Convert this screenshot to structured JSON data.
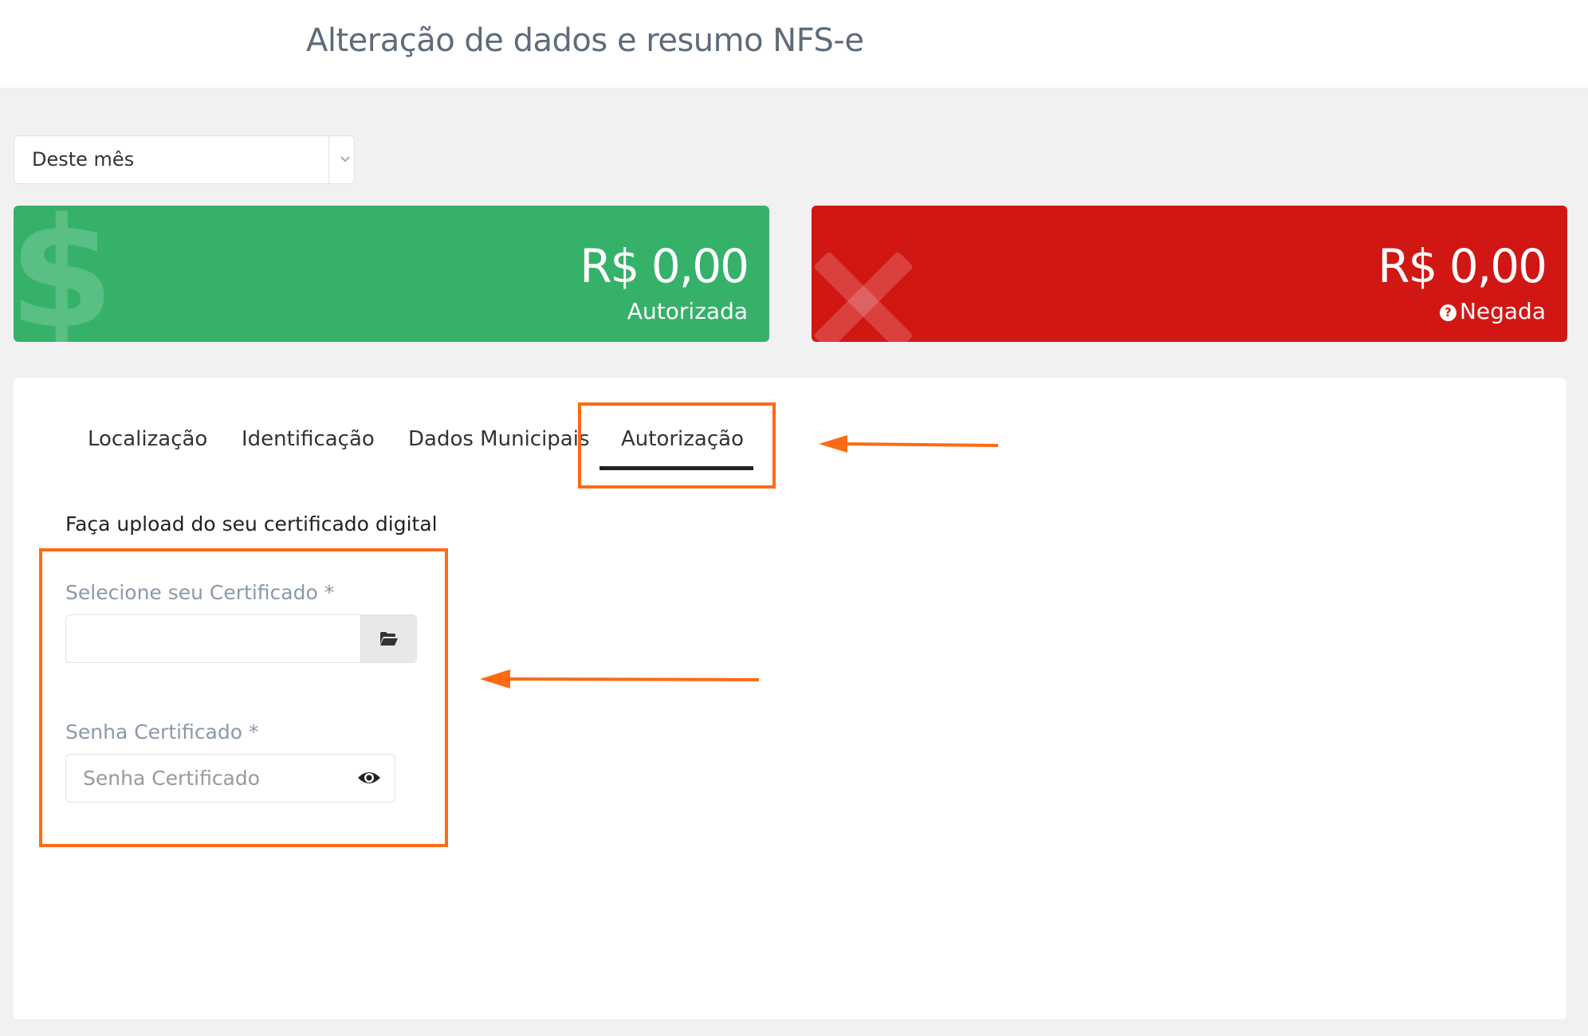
{
  "header": {
    "title": "Alteração de dados e resumo NFS-e"
  },
  "filter": {
    "period_value": "Deste mês"
  },
  "cards": {
    "authorized": {
      "amount": "R$ 0,00",
      "label": "Autorizada",
      "bg_icon": "dollar-icon",
      "color": "#36b16a"
    },
    "denied": {
      "amount": "R$ 0,00",
      "label": "Negada",
      "bg_icon": "close-icon",
      "color": "#d11714"
    }
  },
  "tabs": [
    {
      "label": "Localização",
      "active": false
    },
    {
      "label": "Identificação",
      "active": false
    },
    {
      "label": "Dados Municipais",
      "active": false
    },
    {
      "label": "Autorização",
      "active": true
    }
  ],
  "form": {
    "heading": "Faça upload do seu certificado digital",
    "certificate": {
      "label": "Selecione seu Certificado *",
      "value": "",
      "button_icon": "folder-open-icon"
    },
    "password": {
      "label": "Senha Certificado *",
      "placeholder": "Senha Certificado",
      "value": "",
      "toggle_icon": "eye-icon"
    }
  },
  "annotations": {
    "highlight_color": "#ff6a14"
  }
}
